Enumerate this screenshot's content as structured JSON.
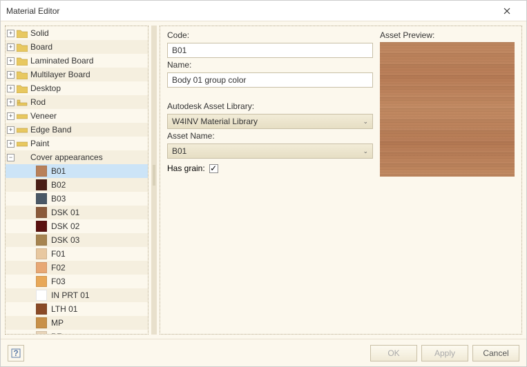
{
  "window": {
    "title": "Material Editor"
  },
  "tree": {
    "categories": [
      {
        "label": "Solid",
        "icon": "#e8c860"
      },
      {
        "label": "Board",
        "icon": "#e8c860"
      },
      {
        "label": "Laminated Board",
        "icon": "#e8c860"
      },
      {
        "label": "Multilayer Board",
        "icon": "#e8c860"
      },
      {
        "label": "Desktop",
        "icon": "#e8c860"
      },
      {
        "label": "Rod",
        "icon": "#e8c860"
      },
      {
        "label": "Veneer",
        "icon": "#e8c860"
      },
      {
        "label": "Edge Band",
        "icon": "#e8c860"
      },
      {
        "label": "Paint",
        "icon": "#e8c860"
      }
    ],
    "expanded": {
      "label": "Cover appearances"
    },
    "appearances": [
      {
        "label": "B01",
        "color": "#b8805a",
        "selected": true
      },
      {
        "label": "B02",
        "color": "#4a1e16"
      },
      {
        "label": "B03",
        "color": "#4a5866"
      },
      {
        "label": "DSK 01",
        "color": "#8a5a3a"
      },
      {
        "label": "DSK 02",
        "color": "#5a1210"
      },
      {
        "label": "DSK 03",
        "color": "#a68450"
      },
      {
        "label": "F01",
        "color": "#e8c8a0"
      },
      {
        "label": "F02",
        "color": "#e8a874"
      },
      {
        "label": "F03",
        "color": "#e8a858"
      },
      {
        "label": "IN PRT 01",
        "color": "#ffffff"
      },
      {
        "label": "LTH 01",
        "color": "#8a4a26"
      },
      {
        "label": "MP",
        "color": "#c89048"
      },
      {
        "label": "PF",
        "color": "#e8d4b8"
      }
    ]
  },
  "form": {
    "code_label": "Code:",
    "code_value": "B01",
    "name_label": "Name:",
    "name_value": "Body 01 group color",
    "library_label": "Autodesk Asset Library:",
    "library_value": "W4INV Material Library",
    "asset_label": "Asset Name:",
    "asset_value": "B01",
    "grain_label": "Has grain:",
    "grain_checked": "✓",
    "preview_label": "Asset Preview:"
  },
  "footer": {
    "ok": "OK",
    "apply": "Apply",
    "cancel": "Cancel"
  }
}
